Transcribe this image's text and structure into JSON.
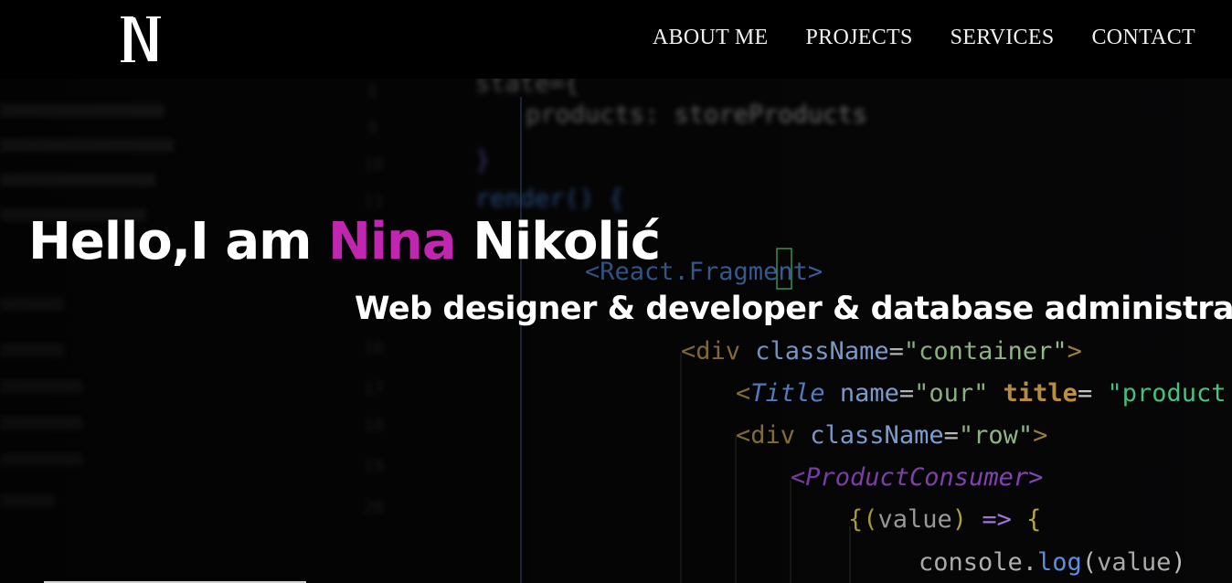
{
  "nav": {
    "logo_alt": "N",
    "links": [
      {
        "label": "ABOUT ME"
      },
      {
        "label": "PROJECTS"
      },
      {
        "label": "SERVICES"
      },
      {
        "label": "CONTACT"
      }
    ]
  },
  "hero": {
    "greeting": "Hello,I am",
    "first_name": "Nina",
    "last_name": "Nikolić",
    "subtitle": "Web designer & developer & database administrator",
    "accent_color": "#c026b0",
    "background_code": [
      "state={",
      "products: storeProducts",
      "}",
      "render() {",
      "<React.Fragment>",
      "<div className=\"container\">",
      "<Title name=\"our\" title= \"product",
      "<div className=\"row\">",
      "<ProductConsumer>",
      "{(value) => {",
      "console.log(value)"
    ]
  }
}
